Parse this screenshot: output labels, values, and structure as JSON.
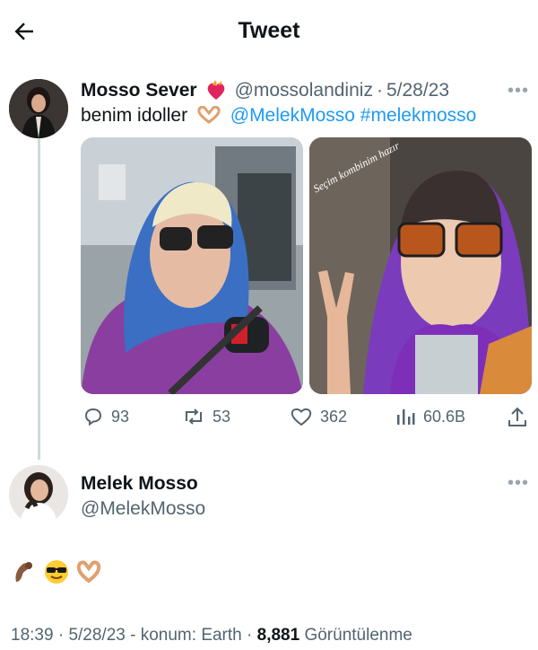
{
  "header": {
    "title": "Tweet"
  },
  "tweet": {
    "name": "Mosso Sever",
    "handle": "@mossolandiniz",
    "date": "5/28/23",
    "text_prefix": "benim idoller",
    "mention": "@MelekMosso",
    "hashtag": "#melekmosso",
    "photo_left_caption": "",
    "photo_right_caption": "Seçim kombinim hazır",
    "actions": {
      "replies": "93",
      "retweets": "53",
      "likes": "362",
      "views": "60.6B"
    }
  },
  "reply": {
    "name": "Melek Mosso",
    "handle": "@MelekMosso",
    "emojis": [
      "pinched-fingers",
      "sunglasses-face",
      "heart-hands"
    ]
  },
  "footer": {
    "time": "18:39",
    "date": "5/28/23",
    "location_label": "konum: Earth",
    "view_count": "8,881",
    "view_label": "Görüntülenme"
  },
  "colors": {
    "accent": "#1d9bf0",
    "muted": "#536471",
    "text": "#0f1419"
  },
  "icons": [
    "back-arrow-icon",
    "heart-fire-emoji",
    "heart-hands-emoji",
    "more-icon",
    "reply-icon",
    "retweet-icon",
    "like-icon",
    "views-icon",
    "share-icon"
  ]
}
